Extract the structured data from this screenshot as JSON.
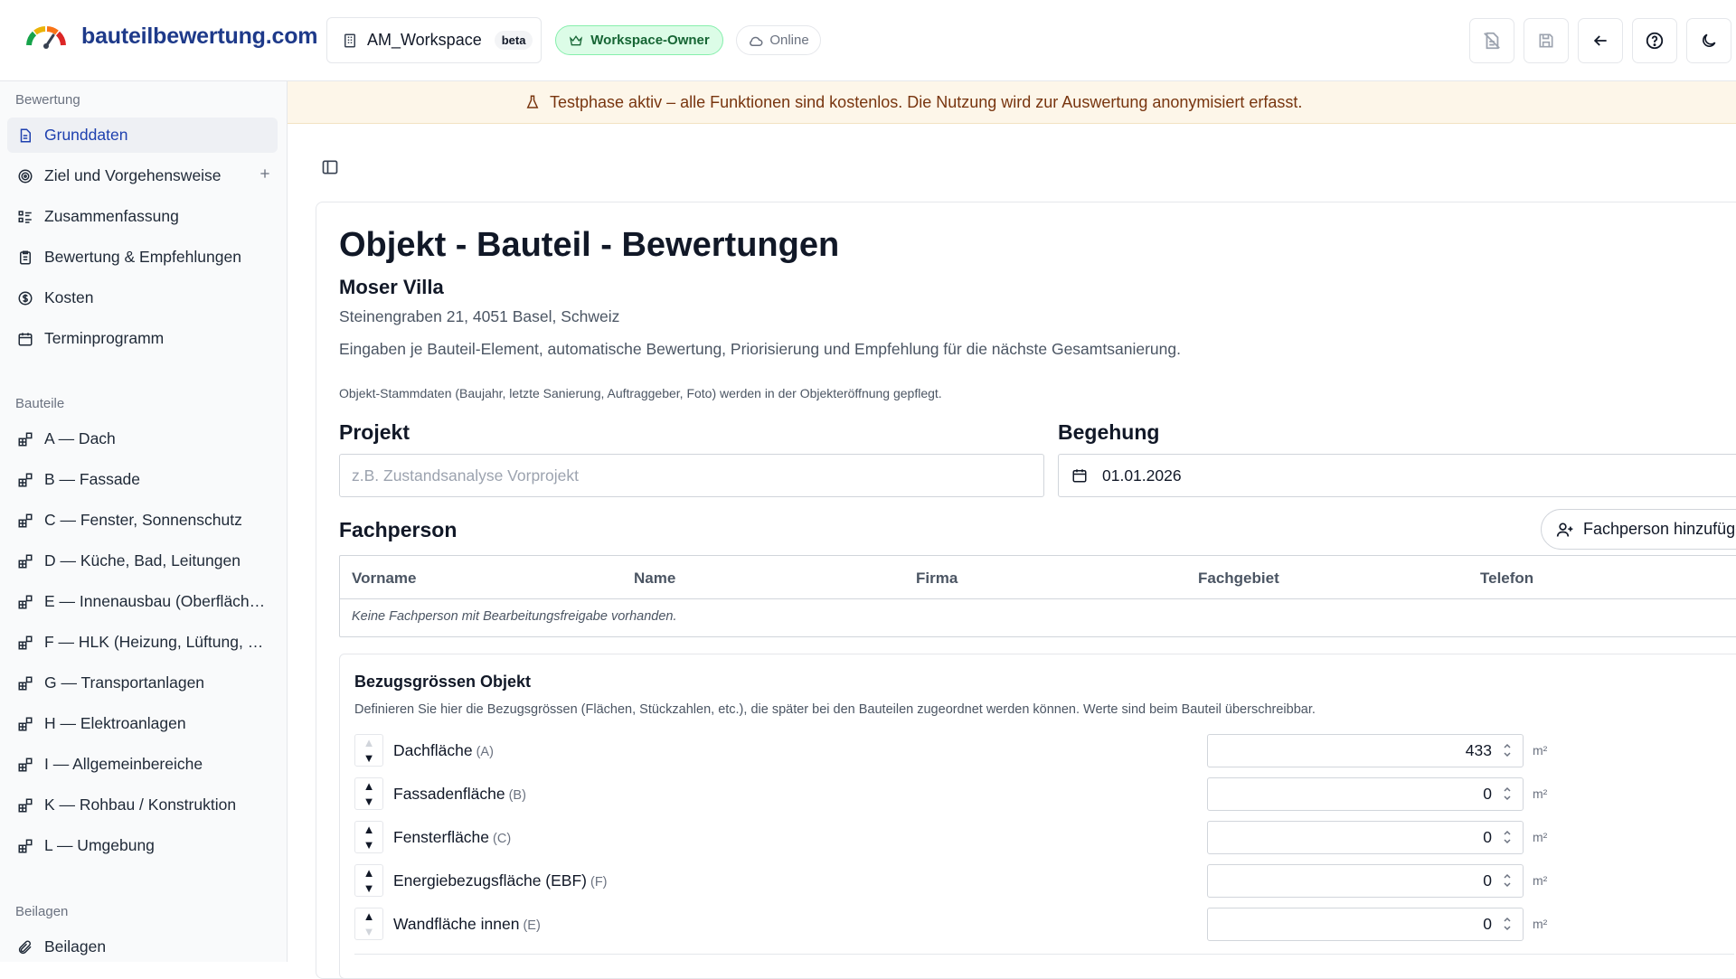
{
  "header": {
    "brand": "bauteilbewertung.com",
    "workspace_name": "AM_Workspace",
    "workspace_badge": "beta",
    "role_badge": "Workspace-Owner",
    "status": "Online",
    "icons": [
      "file-off-icon",
      "save-icon",
      "arrow-left-icon",
      "help-icon",
      "moon-icon"
    ]
  },
  "banner": {
    "text": "Testphase aktiv – alle Funktionen sind kostenlos. Die Nutzung wird zur Auswertung anonymisiert erfasst."
  },
  "sidebar": {
    "sections": [
      {
        "label": "Bewertung",
        "items": [
          {
            "label": "Grunddaten",
            "icon": "document-icon",
            "active": true
          },
          {
            "label": "Ziel und Vorgehensweise",
            "icon": "target-icon",
            "plus": true
          },
          {
            "label": "Zusammenfassung",
            "icon": "list-icon"
          },
          {
            "label": "Bewertung & Empfehlungen",
            "icon": "clipboard-icon"
          },
          {
            "label": "Kosten",
            "icon": "dollar-icon"
          },
          {
            "label": "Terminprogramm",
            "icon": "calendar-icon"
          }
        ]
      },
      {
        "label": "Bauteile",
        "items": [
          {
            "label": "A — Dach",
            "icon": "blocks-icon"
          },
          {
            "label": "B — Fassade",
            "icon": "blocks-icon"
          },
          {
            "label": "C — Fenster, Sonnenschutz",
            "icon": "blocks-icon"
          },
          {
            "label": "D — Küche, Bad, Leitungen",
            "icon": "blocks-icon"
          },
          {
            "label": "E — Innenausbau (Oberfläch…",
            "icon": "blocks-icon"
          },
          {
            "label": "F — HLK (Heizung, Lüftung, …",
            "icon": "blocks-icon"
          },
          {
            "label": "G — Transportanlagen",
            "icon": "blocks-icon"
          },
          {
            "label": "H — Elektroanlagen",
            "icon": "blocks-icon"
          },
          {
            "label": "I — Allgemeinbereiche",
            "icon": "blocks-icon"
          },
          {
            "label": "K — Rohbau / Konstruktion",
            "icon": "blocks-icon"
          },
          {
            "label": "L — Umgebung",
            "icon": "blocks-icon"
          }
        ]
      },
      {
        "label": "Beilagen",
        "items": [
          {
            "label": "Beilagen",
            "icon": "paperclip-icon"
          }
        ]
      }
    ]
  },
  "main": {
    "title": "Objekt - Bauteil - Bewertungen",
    "object_name": "Moser Villa",
    "address": "Steinengraben 21, 4051 Basel, Schweiz",
    "description": "Eingaben je Bauteil-Element, automatische Bewertung, Priorisierung und Empfehlung für die nächste Gesamtsanierung.",
    "note": "Objekt-Stammdaten (Baujahr, letzte Sanierung, Auftraggeber, Foto) werden in der Objekteröffnung gepflegt.",
    "projekt": {
      "label": "Projekt",
      "placeholder": "z.B. Zustandsanalyse Vorprojekt",
      "value": ""
    },
    "begehung": {
      "label": "Begehung",
      "value": "01.01.2026"
    },
    "fachperson": {
      "label": "Fachperson",
      "add_button": "Fachperson hinzufüge",
      "columns": [
        "Vorname",
        "Name",
        "Firma",
        "Fachgebiet",
        "Telefon"
      ],
      "empty_text": "Keine Fachperson mit Bearbeitungsfreigabe vorhanden."
    },
    "bezugsgroessen": {
      "title": "Bezugsgrössen Objekt",
      "description": "Definieren Sie hier die Bezugsgrössen (Flächen, Stückzahlen, etc.), die später bei den Bauteilen zugeordnet werden können. Werte sind beim Bauteil überschreibbar.",
      "rows": [
        {
          "label": "Dachfläche",
          "code": "(A)",
          "value": "433",
          "unit": "m²",
          "up_enabled": false,
          "down_enabled": true
        },
        {
          "label": "Fassadenfläche",
          "code": "(B)",
          "value": "0",
          "unit": "m²",
          "up_enabled": true,
          "down_enabled": true
        },
        {
          "label": "Fensterfläche",
          "code": "(C)",
          "value": "0",
          "unit": "m²",
          "up_enabled": true,
          "down_enabled": true
        },
        {
          "label": "Energiebezugsfläche (EBF)",
          "code": "(F)",
          "value": "0",
          "unit": "m²",
          "up_enabled": true,
          "down_enabled": true
        },
        {
          "label": "Wandfläche innen",
          "code": "(E)",
          "value": "0",
          "unit": "m²",
          "up_enabled": true,
          "down_enabled": false
        }
      ]
    }
  }
}
